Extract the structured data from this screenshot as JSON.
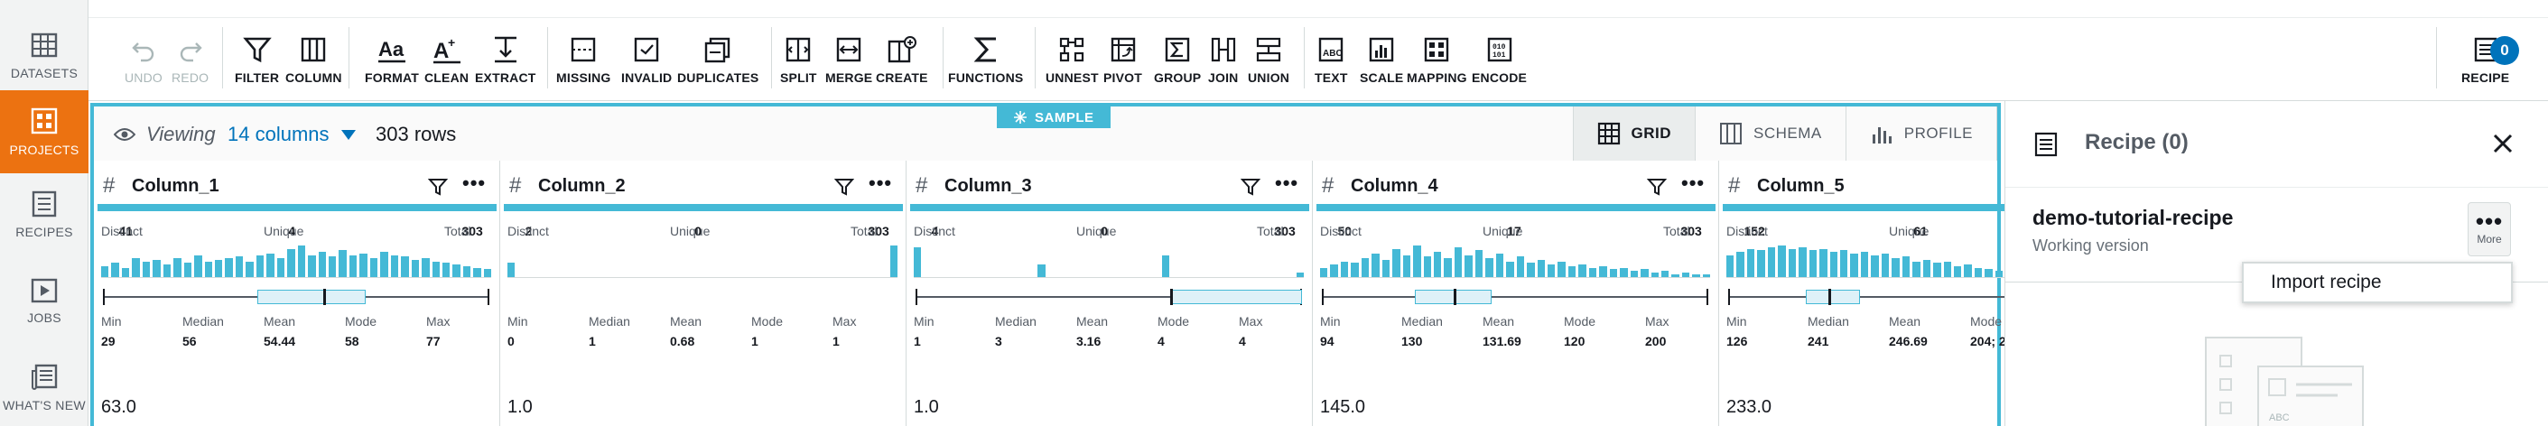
{
  "nav": {
    "items": [
      {
        "label": "DATASETS",
        "icon": "table-icon",
        "active": false
      },
      {
        "label": "PROJECTS",
        "icon": "projects-icon",
        "active": true
      },
      {
        "label": "RECIPES",
        "icon": "recipe-icon",
        "active": false
      },
      {
        "label": "JOBS",
        "icon": "play-icon",
        "active": false
      },
      {
        "label": "WHAT'S NEW",
        "icon": "news-icon",
        "active": false
      }
    ]
  },
  "toolbar": {
    "undo": "UNDO",
    "redo": "REDO",
    "filter": "FILTER",
    "column": "COLUMN",
    "format": "FORMAT",
    "clean": "CLEAN",
    "extract": "EXTRACT",
    "missing": "MISSING",
    "invalid": "INVALID",
    "duplicates": "DUPLICATES",
    "split": "SPLIT",
    "merge": "MERGE",
    "create": "CREATE",
    "functions": "FUNCTIONS",
    "unnest": "UNNEST",
    "pivot": "PIVOT",
    "group": "GROUP",
    "join": "JOIN",
    "union": "UNION",
    "text": "TEXT",
    "scale": "SCALE",
    "mapping": "MAPPING",
    "encode": "ENCODE",
    "recipe": "RECIPE",
    "recipe_count": "0"
  },
  "gridbar": {
    "viewing": "Viewing",
    "columns": "14 columns",
    "rows": "303 rows",
    "sample": "SAMPLE",
    "tabs": {
      "grid": "GRID",
      "schema": "SCHEMA",
      "profile": "PROFILE"
    }
  },
  "columns": [
    {
      "name": "Column_1",
      "distinct_label": "Distinct",
      "distinct": "41",
      "unique_label": "Unique",
      "unique": "4",
      "total_label": "Total",
      "total": "303",
      "hist": [
        0.35,
        0.45,
        0.3,
        0.6,
        0.5,
        0.55,
        0.4,
        0.6,
        0.45,
        0.7,
        0.5,
        0.55,
        0.6,
        0.65,
        0.5,
        0.7,
        0.75,
        0.6,
        0.9,
        1.0,
        0.7,
        0.8,
        0.65,
        0.85,
        0.7,
        0.75,
        0.6,
        0.8,
        0.7,
        0.65,
        0.55,
        0.6,
        0.5,
        0.45,
        0.4,
        0.35,
        0.3,
        0.25
      ],
      "box": {
        "min": 0.0,
        "q1": 0.4,
        "median": 0.57,
        "q3": 0.68,
        "max": 1.0
      },
      "stats": {
        "min_label": "Min",
        "min": "29",
        "median_label": "Median",
        "median": "56",
        "mean_label": "Mean",
        "mean": "54.44",
        "mode_label": "Mode",
        "mode": "58",
        "max_label": "Max",
        "max": "77"
      },
      "value": "63.0"
    },
    {
      "name": "Column_2",
      "distinct_label": "Distinct",
      "distinct": "2",
      "unique_label": "Unique",
      "unique": "0",
      "total_label": "Total",
      "total": "303",
      "hist": [
        0.45,
        0,
        0,
        0,
        0,
        0,
        0,
        0,
        0,
        0,
        0,
        0,
        0,
        0,
        0,
        0,
        0,
        0,
        0,
        0,
        0,
        0,
        0,
        0,
        0,
        0,
        0,
        0,
        0,
        0,
        0,
        0,
        0,
        0,
        0,
        0,
        0,
        1.0
      ],
      "box": null,
      "stats": {
        "min_label": "Min",
        "min": "0",
        "median_label": "Median",
        "median": "1",
        "mean_label": "Mean",
        "mean": "0.68",
        "mode_label": "Mode",
        "mode": "1",
        "max_label": "Max",
        "max": "1"
      },
      "value": "1.0"
    },
    {
      "name": "Column_3",
      "distinct_label": "Distinct",
      "distinct": "4",
      "unique_label": "Unique",
      "unique": "0",
      "total_label": "Total",
      "total": "303",
      "hist": [
        0.95,
        0,
        0,
        0,
        0,
        0,
        0,
        0,
        0,
        0,
        0,
        0,
        0.4,
        0,
        0,
        0,
        0,
        0,
        0,
        0,
        0,
        0,
        0,
        0,
        0.7,
        0,
        0,
        0,
        0,
        0,
        0,
        0,
        0,
        0,
        0,
        0,
        0,
        0.15
      ],
      "box": {
        "min": 0.0,
        "q1": 0.66,
        "median": 0.66,
        "q3": 1.0,
        "max": 1.0
      },
      "stats": {
        "min_label": "Min",
        "min": "1",
        "median_label": "Median",
        "median": "3",
        "mean_label": "Mean",
        "mean": "3.16",
        "mode_label": "Mode",
        "mode": "4",
        "max_label": "Max",
        "max": "4"
      },
      "value": "1.0"
    },
    {
      "name": "Column_4",
      "distinct_label": "Distinct",
      "distinct": "50",
      "unique_label": "Unique",
      "unique": "17",
      "total_label": "Total",
      "total": "303",
      "hist": [
        0.3,
        0.4,
        0.5,
        0.45,
        0.6,
        0.75,
        0.55,
        0.9,
        0.7,
        1.0,
        0.65,
        0.8,
        0.6,
        0.95,
        0.7,
        0.85,
        0.6,
        0.75,
        0.5,
        0.65,
        0.45,
        0.55,
        0.4,
        0.5,
        0.35,
        0.4,
        0.3,
        0.35,
        0.25,
        0.3,
        0.2,
        0.25,
        0.15,
        0.2,
        0.1,
        0.15,
        0.1,
        0.1
      ],
      "box": {
        "min": 0.0,
        "q1": 0.24,
        "median": 0.34,
        "q3": 0.44,
        "max": 1.0
      },
      "stats": {
        "min_label": "Min",
        "min": "94",
        "median_label": "Median",
        "median": "130",
        "mean_label": "Mean",
        "mean": "131.69",
        "mode_label": "Mode",
        "mode": "120",
        "max_label": "Max",
        "max": "200"
      },
      "value": "145.0"
    },
    {
      "name": "Column_5",
      "distinct_label": "Distinct",
      "distinct": "152",
      "unique_label": "Unique",
      "unique": "61",
      "total_label": "Total",
      "total": "",
      "hist": [
        0.7,
        0.8,
        0.9,
        0.85,
        0.95,
        1.0,
        0.9,
        0.95,
        0.85,
        0.9,
        0.8,
        0.85,
        0.75,
        0.8,
        0.7,
        0.75,
        0.6,
        0.65,
        0.5,
        0.55,
        0.45,
        0.5,
        0.35,
        0.4,
        0.3,
        0.25,
        0.2,
        0.15,
        0.1,
        0.1,
        0.08,
        0.05,
        0.04,
        0.03,
        0.02,
        0.02,
        0.02,
        0.02
      ],
      "box": {
        "min": 0.0,
        "q1": 0.2,
        "median": 0.26,
        "q3": 0.34,
        "max": 1.0
      },
      "stats": {
        "min_label": "Min",
        "min": "126",
        "median_label": "Median",
        "median": "241",
        "mean_label": "Mean",
        "mean": "246.69",
        "mode_label": "Mode",
        "mode": "204; 2",
        "max_label": "",
        "max": ""
      },
      "value": "233.0"
    }
  ],
  "recipe": {
    "title": "Recipe (0)",
    "name": "demo-tutorial-recipe",
    "subtitle": "Working version",
    "more": "More",
    "menu_item": "Import recipe"
  },
  "colors": {
    "accent": "#44b9d6",
    "nav_active": "#ec7211",
    "link": "#0073bb"
  }
}
